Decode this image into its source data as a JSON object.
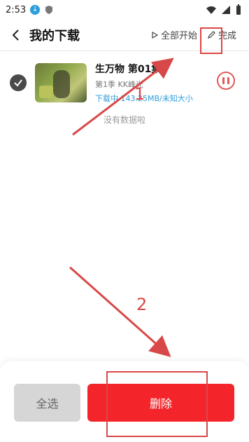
{
  "status_bar": {
    "time": "2:53",
    "icons": [
      "download-icon",
      "shield-icon",
      "wifi-icon",
      "signal-icon",
      "battery-icon"
    ]
  },
  "header": {
    "title": "我的下载",
    "actions": {
      "start_all_label": "全部开始",
      "done_label": "完成"
    }
  },
  "downloads": [
    {
      "title": "生万物 第01集",
      "subtitle": "第1季 KK峰光",
      "progress_text": "下载中 143.25MB/未知大小",
      "selected": true,
      "state_icon": "pause-icon"
    }
  ],
  "empty_hint": "没有数据啦",
  "bottom_actions": {
    "select_all": "全选",
    "delete": "删除"
  },
  "annotations": {
    "step1": "1",
    "step2": "2",
    "color": "#d94848"
  },
  "colors": {
    "accent_red": "#f4252a",
    "progress_blue": "#2d9cdb"
  }
}
